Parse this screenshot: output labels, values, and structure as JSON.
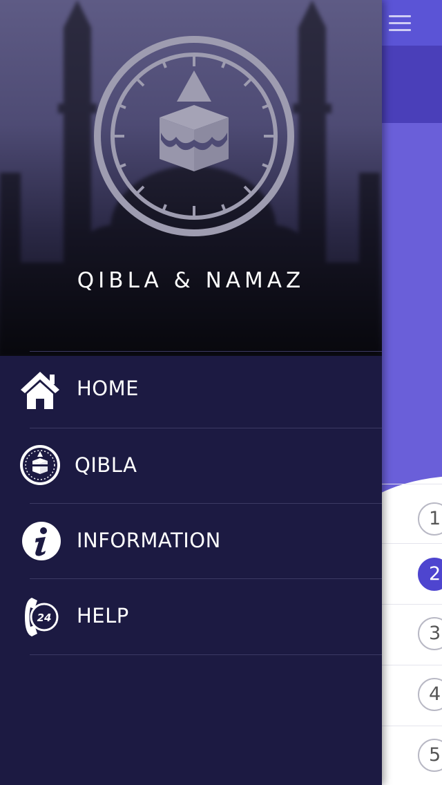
{
  "app": {
    "title": "QIBLA & NAMAZ"
  },
  "drawer": {
    "items": [
      {
        "label": "HOME",
        "icon": "home-icon"
      },
      {
        "label": "QIBLA",
        "icon": "kaaba-compass-icon"
      },
      {
        "label": "INFORMATION",
        "icon": "info-icon"
      },
      {
        "label": "HELP",
        "icon": "phone-24-icon"
      }
    ]
  },
  "main": {
    "list_numbers": [
      "1",
      "2",
      "3",
      "4",
      "5"
    ],
    "active_number": "2"
  },
  "colors": {
    "drawer_bg": "#1c1a42",
    "accent": "#5b54d6",
    "divider": "#3c3a64"
  }
}
